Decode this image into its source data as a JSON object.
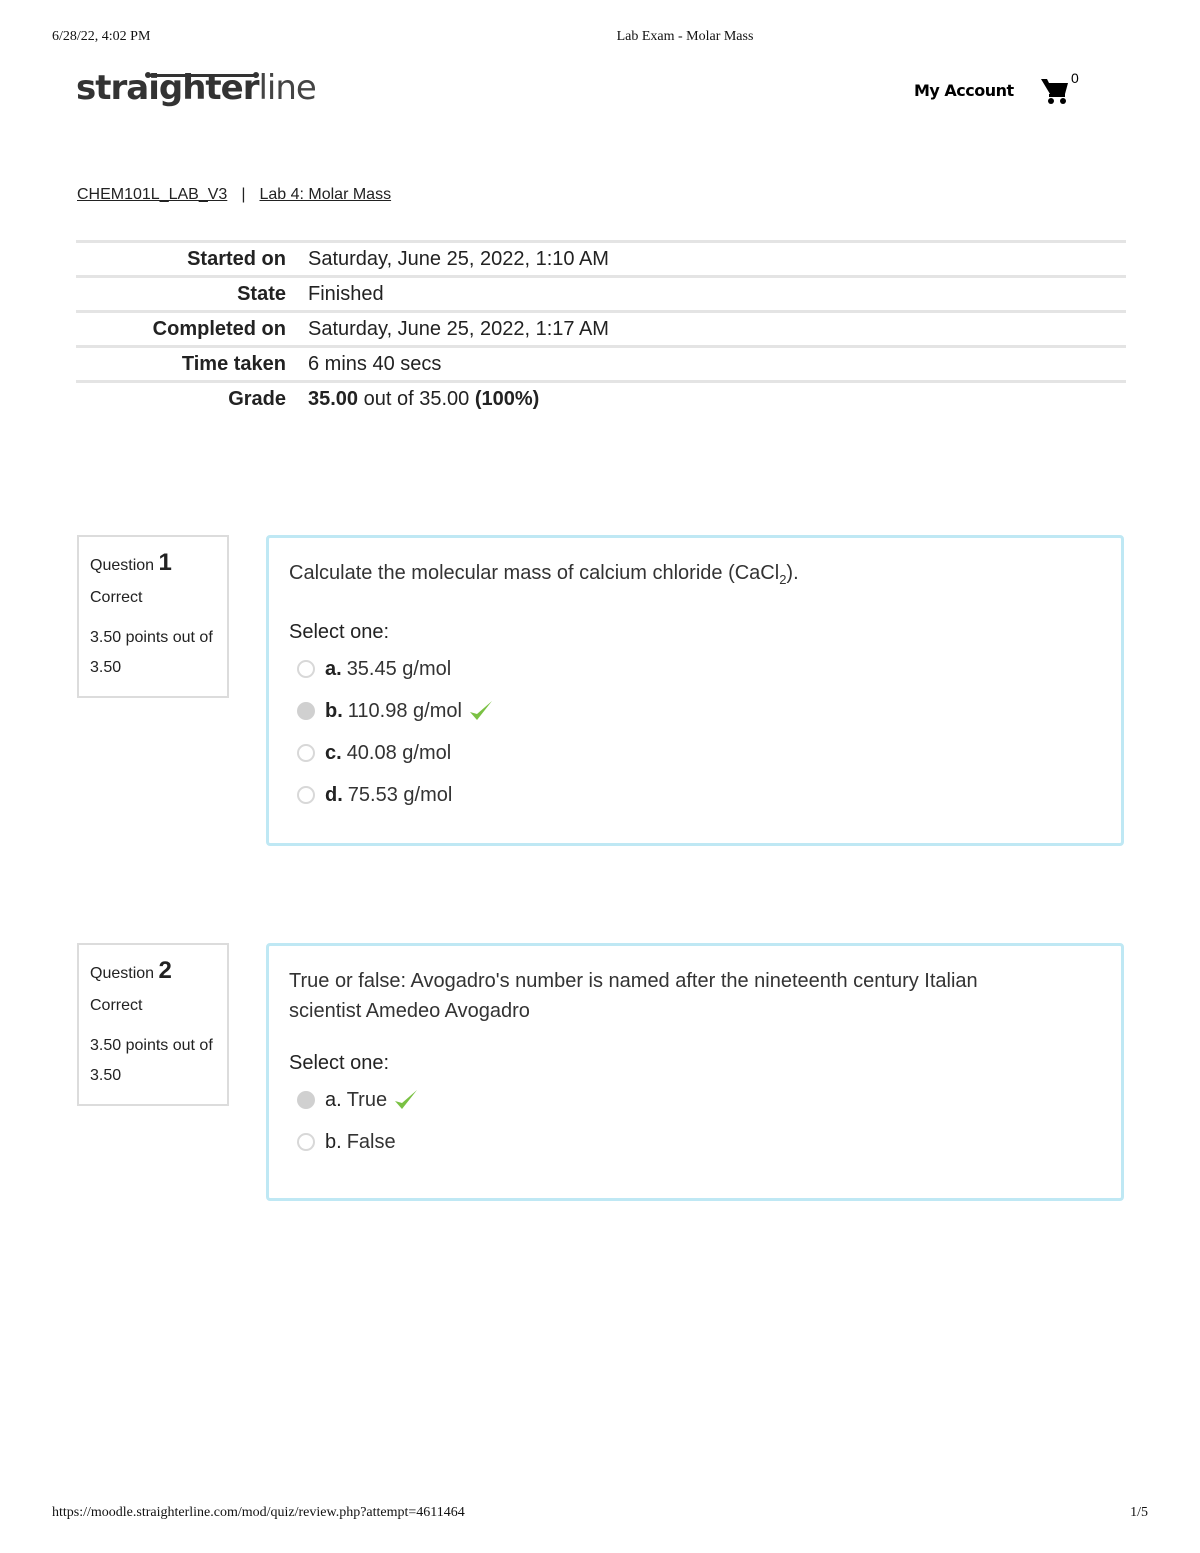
{
  "print_header": {
    "datetime": "6/28/22, 4:02 PM",
    "title": "Lab Exam - Molar Mass"
  },
  "print_footer": {
    "url": "https://moodle.straighterline.com/mod/quiz/review.php?attempt=4611464",
    "page": "1/5"
  },
  "brand": {
    "logo_bold": "straighter",
    "logo_light": "line"
  },
  "header": {
    "my_account": "My Account",
    "cart_count": "0"
  },
  "breadcrumb": {
    "course": "CHEM101L_LAB_V3",
    "separator": "|",
    "lab": "Lab 4: Molar Mass"
  },
  "summary": [
    {
      "label": "Started on",
      "value": "Saturday, June 25, 2022, 1:10 AM"
    },
    {
      "label": "State",
      "value": "Finished"
    },
    {
      "label": "Completed on",
      "value": "Saturday, June 25, 2022, 1:17 AM"
    },
    {
      "label": "Time taken",
      "value": "6 mins 40 secs"
    }
  ],
  "grade": {
    "label": "Grade",
    "score": "35.00",
    "out_of": " out of 35.00 ",
    "percent": "(100%)"
  },
  "questions": [
    {
      "prefix": "Question ",
      "number": "1",
      "state": "Correct",
      "grade": "3.50 points out of 3.50",
      "text_before": "Calculate the molecular mass of calcium chloride (CaCl",
      "text_sub": "2",
      "text_after": ").",
      "select_label": "Select one:",
      "options": [
        {
          "letter": "a.",
          "text": "35.45 g/mol",
          "checked": false,
          "correct": false
        },
        {
          "letter": "b.",
          "text": "110.98 g/mol",
          "checked": true,
          "correct": true
        },
        {
          "letter": "c.",
          "text": "40.08 g/mol",
          "checked": false,
          "correct": false
        },
        {
          "letter": "d.",
          "text": "75.53 g/mol",
          "checked": false,
          "correct": false
        }
      ]
    },
    {
      "prefix": "Question ",
      "number": "2",
      "state": "Correct",
      "grade": "3.50 points out of 3.50",
      "text": "True or false: Avogadro's number is named after the nineteenth century Italian scientist Amedeo Avogadro",
      "select_label": "Select one:",
      "options": [
        {
          "letter": "a.",
          "text": "True",
          "checked": true,
          "correct": true
        },
        {
          "letter": "b.",
          "text": "False",
          "checked": false,
          "correct": false
        }
      ]
    }
  ],
  "colors": {
    "correct_check": "#7ac143",
    "question_border": "#bfe8f4"
  }
}
